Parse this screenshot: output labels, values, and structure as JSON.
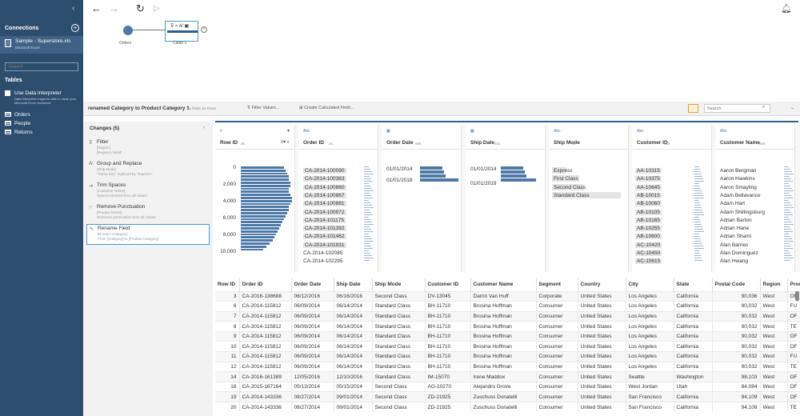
{
  "sidebar": {
    "connections_label": "Connections",
    "add_icon": "plus-icon",
    "connection": {
      "name": "Sample - Superstore.xls",
      "type": "Microsoft Excel"
    },
    "search_placeholder": "Search",
    "tables_label": "Tables",
    "use_interpreter_label": "Use Data Interpreter",
    "interpreter_help": "Data Interpreter might be able to clean your Microsoft Excel workbook.",
    "tables": [
      "Orders",
      "People",
      "Returns"
    ]
  },
  "flow": {
    "nodes": [
      {
        "label": "Orders"
      },
      {
        "label": "Clean 1"
      }
    ]
  },
  "step_bar": {
    "title": "renamed Category to Product Category 1",
    "meta": "21 fields  3K Rows",
    "filter_label": "Filter Values...",
    "calc_label": "Create Calculated Field...",
    "search_placeholder": "Search"
  },
  "changes": {
    "title": "Changes (5)",
    "items": [
      {
        "icon": "filter-icon",
        "title": "Filter",
        "d1": "[Region]",
        "d2": "[Region]='West'"
      },
      {
        "icon": "group-icon",
        "title": "Group and Replace",
        "d1": "[Ship Mode]",
        "d2": "\"Same Day\" replaced by \"Express\""
      },
      {
        "icon": "trim-icon",
        "title": "Trim Spaces",
        "d1": "[Customer Name]",
        "d2": "Spaces trimmed from all values"
      },
      {
        "icon": "punctuation-icon",
        "title": "Remove Punctuation",
        "d1": "[Product Name]",
        "d2": "Removes punctuation from all values"
      },
      {
        "icon": "rename-icon",
        "title": "Rename Field",
        "d1": "[Product Category]",
        "d2": "From [Category] to [Product Category]"
      }
    ]
  },
  "profile": {
    "cards": [
      {
        "type": "#",
        "name": "Row ID",
        "count": "3K"
      },
      {
        "type": "Abc",
        "name": "Order ID",
        "count": "2K"
      },
      {
        "type": "date",
        "name": "Order Date",
        "count": "895"
      },
      {
        "type": "date",
        "name": "Ship Date",
        "count": "931"
      },
      {
        "type": "Abc",
        "name": "Ship Mode",
        "count": "4"
      },
      {
        "type": "Abc",
        "name": "Customer ID",
        "count": "686"
      },
      {
        "type": "Abc",
        "name": "Customer Name",
        "count": "686"
      }
    ],
    "row_id_ticks": [
      "0",
      "2,000",
      "4,000",
      "6,000",
      "8,000",
      "10,000"
    ],
    "order_ids": [
      "CA-2014-100090",
      "CA-2014-100363",
      "CA-2014-100860",
      "CA-2014-100867",
      "CA-2014-100881",
      "CA-2014-100972",
      "CA-2014-101175",
      "CA-2014-101392",
      "CA-2014-101462",
      "CA-2014-101931",
      "CA-2014-102085",
      "CA-2014-102295"
    ],
    "order_date_ticks": [
      "01/01/2014",
      "01/01/2018"
    ],
    "ship_date_ticks": [
      "01/01/2014",
      "01/01/2019"
    ],
    "ship_modes": [
      "Express",
      "First Class",
      "Second Class",
      "Standard Class"
    ],
    "customer_ids": [
      "AA-10315",
      "AA-10375",
      "AA-10645",
      "AB-10015",
      "AB-10060",
      "AB-10105",
      "AB-10165",
      "AB-10255",
      "AB-10600",
      "AC-10420",
      "AC-10450",
      "AC-10615"
    ],
    "customer_names": [
      "Aaron Bergman",
      "Aaron Hawkins",
      "Aaron Smayling",
      "Adam Bellavance",
      "Adam Hart",
      "Adam Shillingsburg",
      "Adrian Barton",
      "Adrian Hane",
      "Adrian Shami",
      "Alan Barnes",
      "Alan Dominguez",
      "Alan Hwang"
    ]
  },
  "table": {
    "columns": [
      "Row ID",
      "Order ID",
      "Order Date",
      "Ship Date",
      "Ship Mode",
      "Customer ID",
      "Customer Name",
      "Segment",
      "Country",
      "City",
      "State",
      "Postal Code",
      "Region",
      "Prod"
    ],
    "rows": [
      [
        "3",
        "CA-2016-138688",
        "06/12/2016",
        "06/16/2016",
        "Second Class",
        "DV-13045",
        "Darrin Van Huff",
        "Corporate",
        "United States",
        "Los Angeles",
        "California",
        "90,036",
        "West",
        "OF"
      ],
      [
        "6",
        "CA-2014-115812",
        "06/09/2014",
        "06/14/2014",
        "Standard Class",
        "BH-11710",
        "Brosina Hoffman",
        "Consumer",
        "United States",
        "Los Angeles",
        "California",
        "90,032",
        "West",
        "FU"
      ],
      [
        "7",
        "CA-2014-115812",
        "06/09/2014",
        "06/14/2014",
        "Standard Class",
        "BH-11710",
        "Brosina Hoffman",
        "Consumer",
        "United States",
        "Los Angeles",
        "California",
        "90,032",
        "West",
        "OF"
      ],
      [
        "8",
        "CA-2014-115812",
        "06/09/2014",
        "06/14/2014",
        "Standard Class",
        "BH-11710",
        "Brosina Hoffman",
        "Consumer",
        "United States",
        "Los Angeles",
        "California",
        "90,032",
        "West",
        "TE"
      ],
      [
        "9",
        "CA-2014-115812",
        "06/09/2014",
        "06/14/2014",
        "Standard Class",
        "BH-11710",
        "Brosina Hoffman",
        "Consumer",
        "United States",
        "Los Angeles",
        "California",
        "90,032",
        "West",
        "OF"
      ],
      [
        "10",
        "CA-2014-115812",
        "06/09/2014",
        "06/14/2014",
        "Standard Class",
        "BH-11710",
        "Brosina Hoffman",
        "Consumer",
        "United States",
        "Los Angeles",
        "California",
        "90,032",
        "West",
        "OF"
      ],
      [
        "11",
        "CA-2014-115812",
        "06/09/2014",
        "06/14/2014",
        "Standard Class",
        "BH-11710",
        "Brosina Hoffman",
        "Consumer",
        "United States",
        "Los Angeles",
        "California",
        "90,032",
        "West",
        "FU"
      ],
      [
        "12",
        "CA-2014-115812",
        "06/09/2014",
        "06/14/2014",
        "Standard Class",
        "BH-11710",
        "Brosina Hoffman",
        "Consumer",
        "United States",
        "Los Angeles",
        "California",
        "90,032",
        "West",
        "TE"
      ],
      [
        "14",
        "CA-2016-161389",
        "12/05/2016",
        "12/10/2016",
        "Standard Class",
        "IM-15070",
        "Irene Maddox",
        "Consumer",
        "United States",
        "Seattle",
        "Washington",
        "98,103",
        "West",
        "OF"
      ],
      [
        "18",
        "CA-2015-167164",
        "05/13/2014",
        "05/15/2014",
        "Second Class",
        "AG-10270",
        "Alejandro Grove",
        "Consumer",
        "United States",
        "West Jordan",
        "Utah",
        "84,084",
        "West",
        "OF"
      ],
      [
        "19",
        "CA-2014-143336",
        "08/27/2014",
        "09/01/2014",
        "Second Class",
        "ZD-21925",
        "Zuschuss Donatelli",
        "Consumer",
        "United States",
        "San Francisco",
        "California",
        "94,109",
        "West",
        "OF"
      ],
      [
        "20",
        "CA-2014-143336",
        "08/27/2014",
        "09/01/2014",
        "Second Class",
        "ZD-21925",
        "Zuschuss Donatelli",
        "Consumer",
        "United States",
        "San Francisco",
        "California",
        "94,109",
        "West",
        "TE"
      ]
    ]
  },
  "colors": {
    "sidebar": "#2d4d6e",
    "accent": "#4e79a7",
    "selection": "#4e95d9"
  }
}
